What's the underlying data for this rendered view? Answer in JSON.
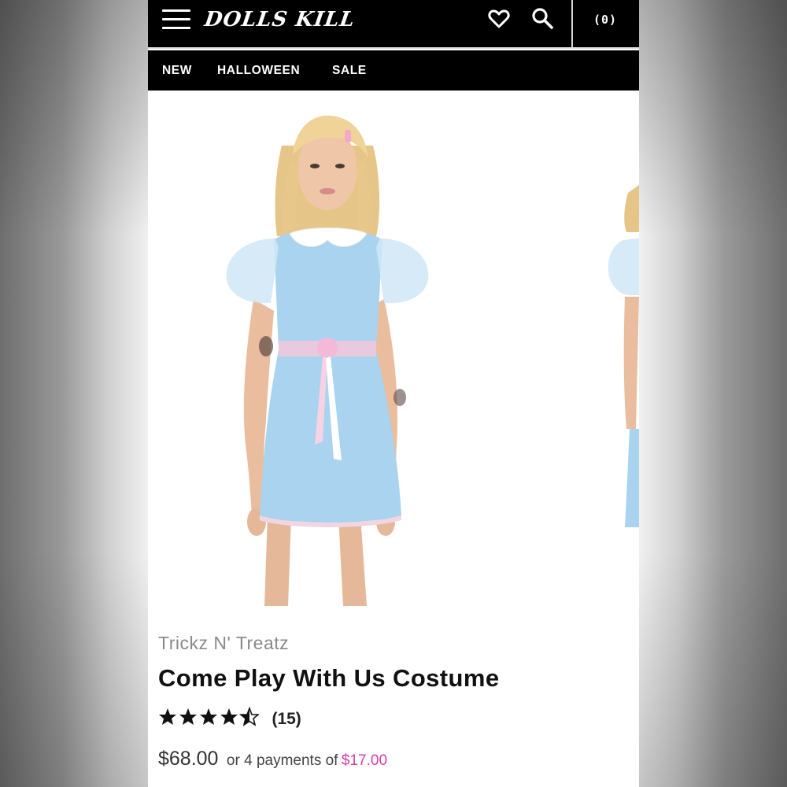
{
  "header": {
    "logo_text": "DOLLS KILL",
    "cart_count": "(0)",
    "icons": [
      "menu-icon",
      "heart-icon",
      "search-icon"
    ]
  },
  "nav": {
    "items": [
      "NEW",
      "HALLOWEEN",
      "SALE"
    ]
  },
  "product": {
    "brand": "Trickz N' Treatz",
    "title": "Come Play With Us Costume",
    "rating": 4.5,
    "review_count": "(15)",
    "price": "$68.00",
    "installment_text": "or 4 payments of",
    "installment_amount": "$17.00"
  },
  "colors": {
    "header_bg": "#000000",
    "accent_pink": "#d63fa8",
    "dress_blue": "#a9d3ee",
    "ribbon_pink": "#f4b8d8"
  }
}
